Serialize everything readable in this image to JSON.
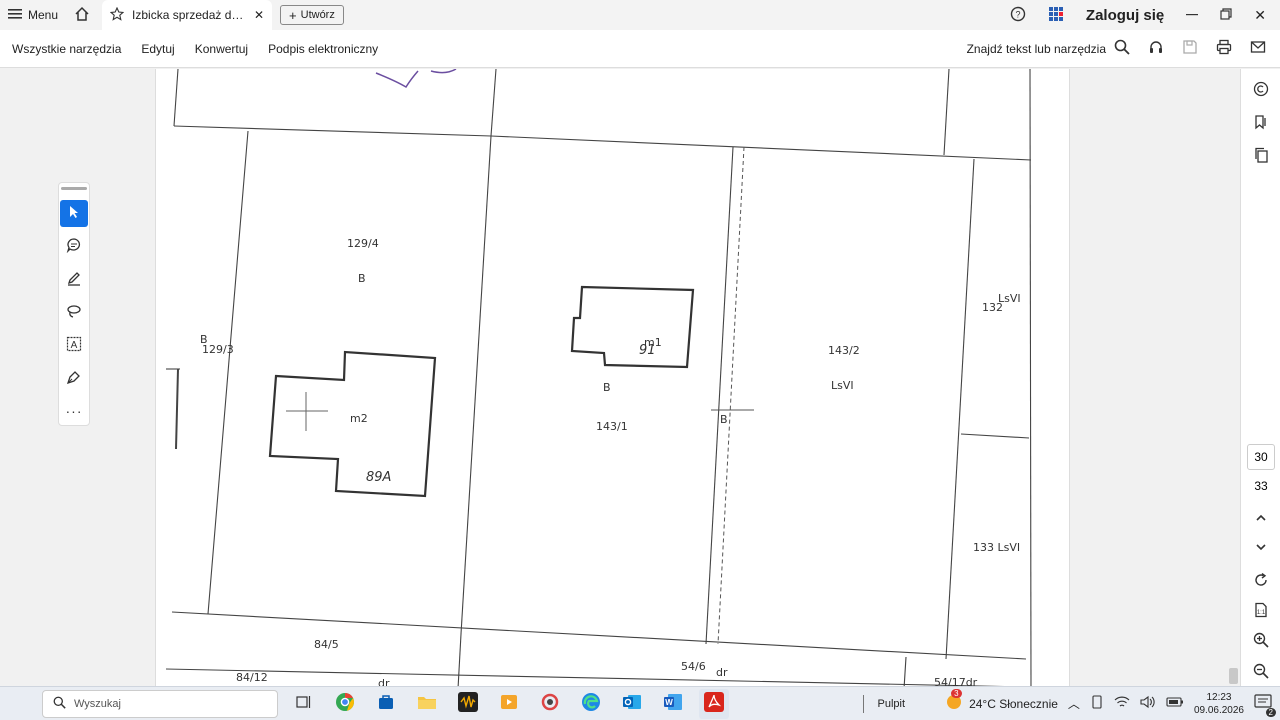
{
  "tabbar": {
    "menu_label": "Menu",
    "tab_title": "Izbicka sprzedaż dział...",
    "create_label": "Utwórz",
    "login_label": "Zaloguj się"
  },
  "toolbar": {
    "items": [
      "Wszystkie narzędzia",
      "Edytuj",
      "Konwertuj",
      "Podpis elektroniczny"
    ],
    "find_label": "Znajdź tekst lub narzędzia"
  },
  "document": {
    "labels": {
      "p129_4": "129/4",
      "b1": "B",
      "b129_3": "B",
      "p129_3": "129/3",
      "m2": "m2",
      "n89a": "89A",
      "m1": "m1",
      "n91": "91",
      "b2": "B",
      "p143_1": "143/1",
      "b3": "B",
      "p143_2": "143/2",
      "lsvi": "LsVI",
      "p132": "132",
      "lsvi2": "LsVI",
      "p133": "133 LsVI",
      "p84_5": "84/5",
      "p54_6": "54/6",
      "dr1": "dr",
      "p84_12": "84/12",
      "dr2": "dr",
      "p54_17": "54/17dr"
    }
  },
  "rightrail": {
    "page_current": "30",
    "page_total": "33"
  },
  "taskbar": {
    "search_placeholder": "Wyszukaj",
    "desktop_label": "Pulpit",
    "weather": "24°C  Słonecznie",
    "weather_badge": "3",
    "time": "12:23",
    "date": "09.06.2026",
    "notif_count": "2"
  },
  "colors": {
    "accent": "#1473e6",
    "pdf_red": "#d9261c"
  }
}
